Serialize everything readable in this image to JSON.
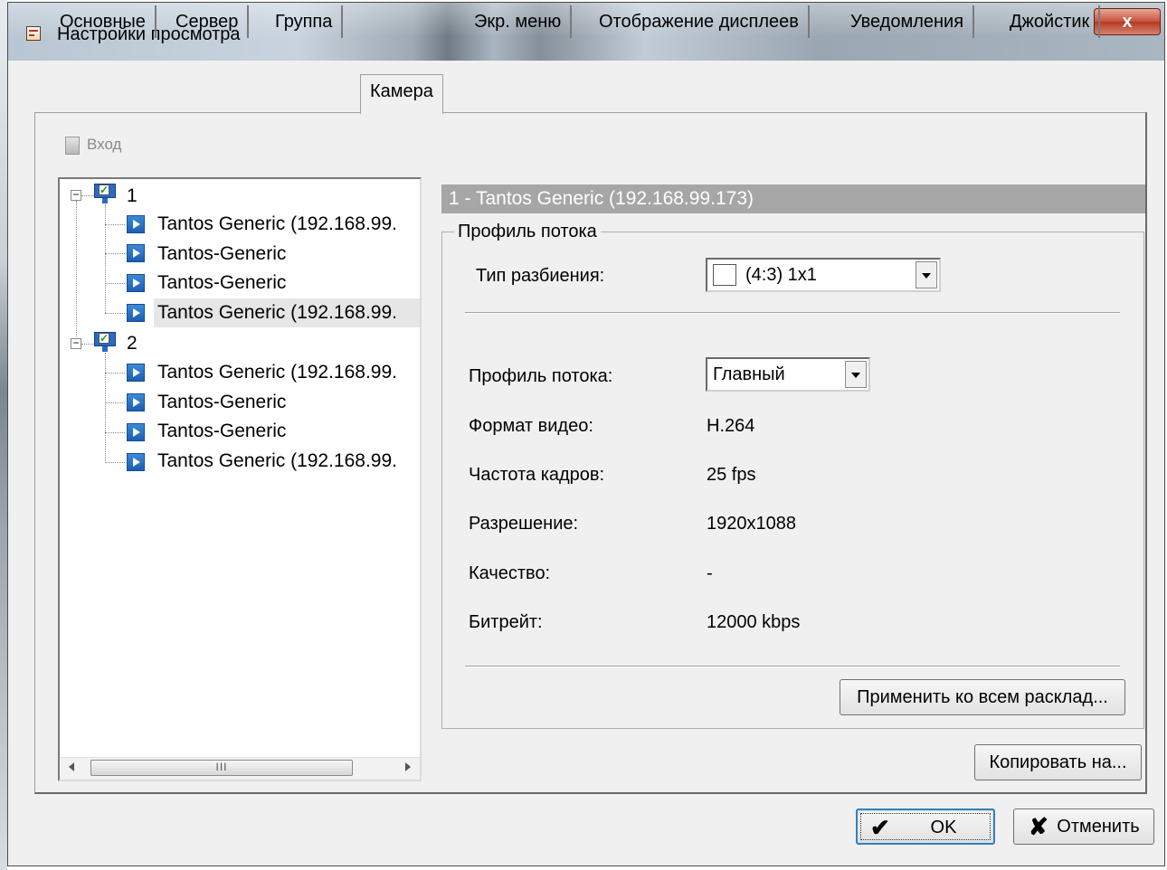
{
  "window": {
    "title": "Настройки просмотра",
    "close_glyph": "x"
  },
  "tabs": [
    {
      "label": "Основные"
    },
    {
      "label": "Сервер"
    },
    {
      "label": "Группа"
    },
    {
      "label": "Камера",
      "active": true
    },
    {
      "label": "Экр. меню"
    },
    {
      "label": "Отображение дисплеев"
    },
    {
      "label": "Уведомления"
    },
    {
      "label": "Джойстик"
    }
  ],
  "toolbar": {
    "login_label": "Вход"
  },
  "tree": {
    "groups": [
      {
        "label": "1",
        "expander": "−",
        "items": [
          {
            "label": "Tantos Generic (192.168.99."
          },
          {
            "label": "Tantos-Generic"
          },
          {
            "label": "Tantos-Generic"
          },
          {
            "label": "Tantos Generic (192.168.99.",
            "selected": true
          }
        ]
      },
      {
        "label": "2",
        "expander": "−",
        "items": [
          {
            "label": "Tantos Generic (192.168.99."
          },
          {
            "label": "Tantos-Generic"
          },
          {
            "label": "Tantos-Generic"
          },
          {
            "label": "Tantos Generic (192.168.99."
          }
        ]
      }
    ],
    "scrollbar_thumb_glyph": "III"
  },
  "camera": {
    "header": "1 - Tantos Generic (192.168.99.173)",
    "group_title": "Профиль потока",
    "split_type_label": "Тип разбиения:",
    "split_type_value": "(4:3) 1x1",
    "stream_profile_label": "Профиль потока:",
    "stream_profile_value": "Главный",
    "video_format_label": "Формат видео:",
    "video_format_value": "H.264",
    "frame_rate_label": "Частота кадров:",
    "frame_rate_value": "25 fps",
    "resolution_label": "Разрешение:",
    "resolution_value": "1920x1088",
    "quality_label": "Качество:",
    "quality_value": "-",
    "bitrate_label": "Битрейт:",
    "bitrate_value": "12000 kbps",
    "apply_all_label": "Применить ко всем расклад...",
    "copy_to_label": "Копировать на..."
  },
  "footer": {
    "ok_label": "OK",
    "ok_icon": "✔",
    "cancel_label": "Отменить",
    "cancel_icon": "✘"
  },
  "colors": {
    "header_bg": "#a6a6a6",
    "close_button": "#c9503a",
    "tree_icon": "#2a6bc0"
  }
}
